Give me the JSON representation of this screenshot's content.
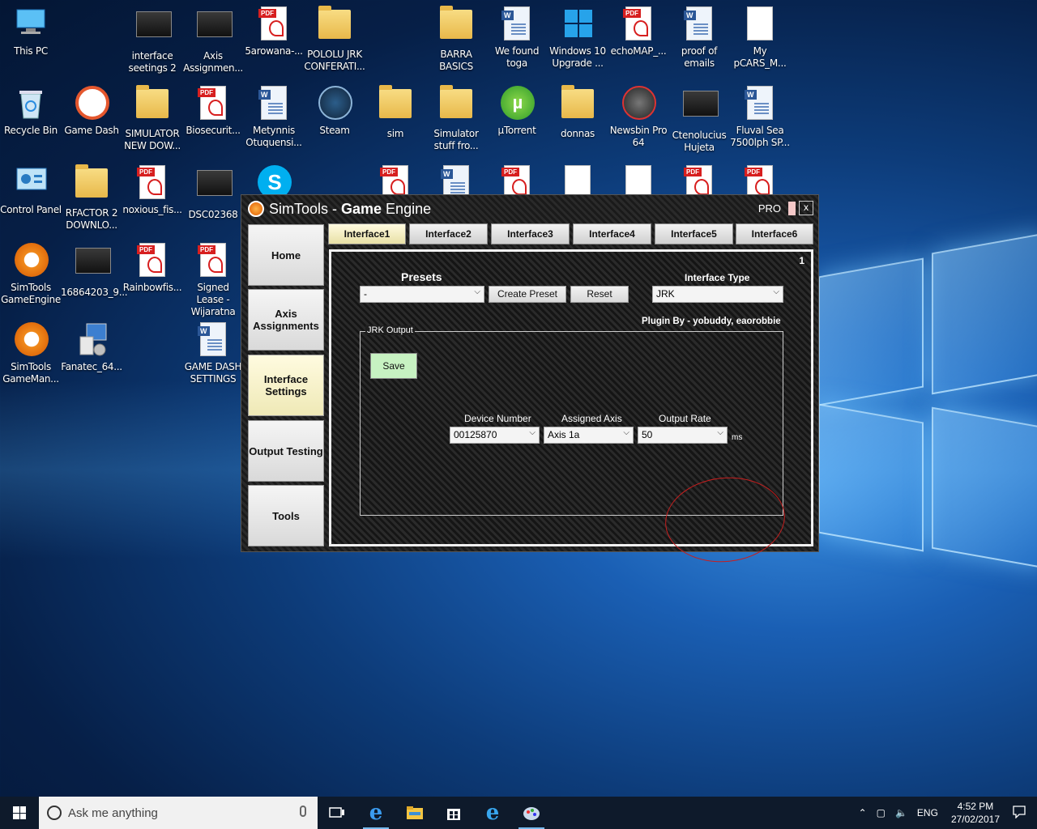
{
  "desktop_icons": [
    {
      "label": "This PC",
      "kind": "pc"
    },
    {
      "label": "interface seetings 2",
      "kind": "thumb"
    },
    {
      "label": "Axis Assignmen...",
      "kind": "thumb"
    },
    {
      "label": "5arowana-...",
      "kind": "pdf"
    },
    {
      "label": "POLOLU JRK CONFERATI...",
      "kind": "folder"
    },
    {
      "label": "BARRA BASICS",
      "kind": "folder"
    },
    {
      "label": "We found toga",
      "kind": "word"
    },
    {
      "label": "Windows 10 Upgrade ...",
      "kind": "win"
    },
    {
      "label": "echoMAP_...",
      "kind": "pdf"
    },
    {
      "label": "proof of emails",
      "kind": "word"
    },
    {
      "label": "My pCARS_M...",
      "kind": "blank"
    },
    {
      "label": "Recycle Bin",
      "kind": "bin"
    },
    {
      "label": "Game Dash",
      "kind": "gamedash"
    },
    {
      "label": "SIMULATOR NEW DOW...",
      "kind": "folder"
    },
    {
      "label": "Biosecurit...",
      "kind": "pdf"
    },
    {
      "label": "Metynnis Otuquensi...",
      "kind": "word"
    },
    {
      "label": "Steam",
      "kind": "steam"
    },
    {
      "label": "sim",
      "kind": "folder"
    },
    {
      "label": "Simulator stuff fro...",
      "kind": "folder"
    },
    {
      "label": "µTorrent",
      "kind": "utorrent"
    },
    {
      "label": "donnas",
      "kind": "folder"
    },
    {
      "label": "Newsbin Pro 64",
      "kind": "newsbin"
    },
    {
      "label": "Ctenolucius Hujeta",
      "kind": "thumb"
    },
    {
      "label": "Fluval Sea 7500lph SP...",
      "kind": "word"
    },
    {
      "label": "Control Panel",
      "kind": "cpanel"
    },
    {
      "label": "RFACTOR 2 DOWNLO...",
      "kind": "folder"
    },
    {
      "label": "noxious_fis...",
      "kind": "pdf"
    },
    {
      "label": "DSC02368",
      "kind": "thumb"
    },
    {
      "label": "SimTools GameEngine",
      "kind": "simtools"
    },
    {
      "label": "16864203_9...",
      "kind": "thumb"
    },
    {
      "label": "Rainbowfis...",
      "kind": "pdf"
    },
    {
      "label": "Signed Lease - Wijaratna",
      "kind": "pdf"
    },
    {
      "label": "SimTools GameMan...",
      "kind": "simtools"
    },
    {
      "label": "Fanatec_64...",
      "kind": "installer"
    },
    {
      "label": "GAME DASH SETTINGS",
      "kind": "word"
    }
  ],
  "window": {
    "title_light": "SimTools - ",
    "title_bold": "Game",
    "title_tail": " Engine",
    "pro_label": "PRO",
    "close_label": "x"
  },
  "sidebar": [
    {
      "label": "Home"
    },
    {
      "label": "Axis Assignments"
    },
    {
      "label": "Interface Settings",
      "active": true
    },
    {
      "label": "Output Testing"
    },
    {
      "label": "Tools"
    }
  ],
  "tabs": [
    "Interface1",
    "Interface2",
    "Interface3",
    "Interface4",
    "Interface5",
    "Interface6"
  ],
  "panel": {
    "number": "1",
    "presets_label": "Presets",
    "preset_value": "-",
    "create_preset": "Create Preset",
    "reset": "Reset",
    "interface_type_label": "Interface Type",
    "interface_type_value": "JRK",
    "plugin_by": "Plugin By - yobuddy, eaorobbie",
    "group_title": "JRK Output",
    "save": "Save",
    "device_number_label": "Device Number",
    "device_number_value": "00125870",
    "assigned_axis_label": "Assigned Axis",
    "assigned_axis_value": "Axis 1a",
    "output_rate_label": "Output Rate",
    "output_rate_value": "50",
    "output_rate_unit": "ms"
  },
  "taskbar": {
    "search_placeholder": "Ask me anything",
    "lang": "ENG",
    "time": "4:52 PM",
    "date": "27/02/2017"
  }
}
